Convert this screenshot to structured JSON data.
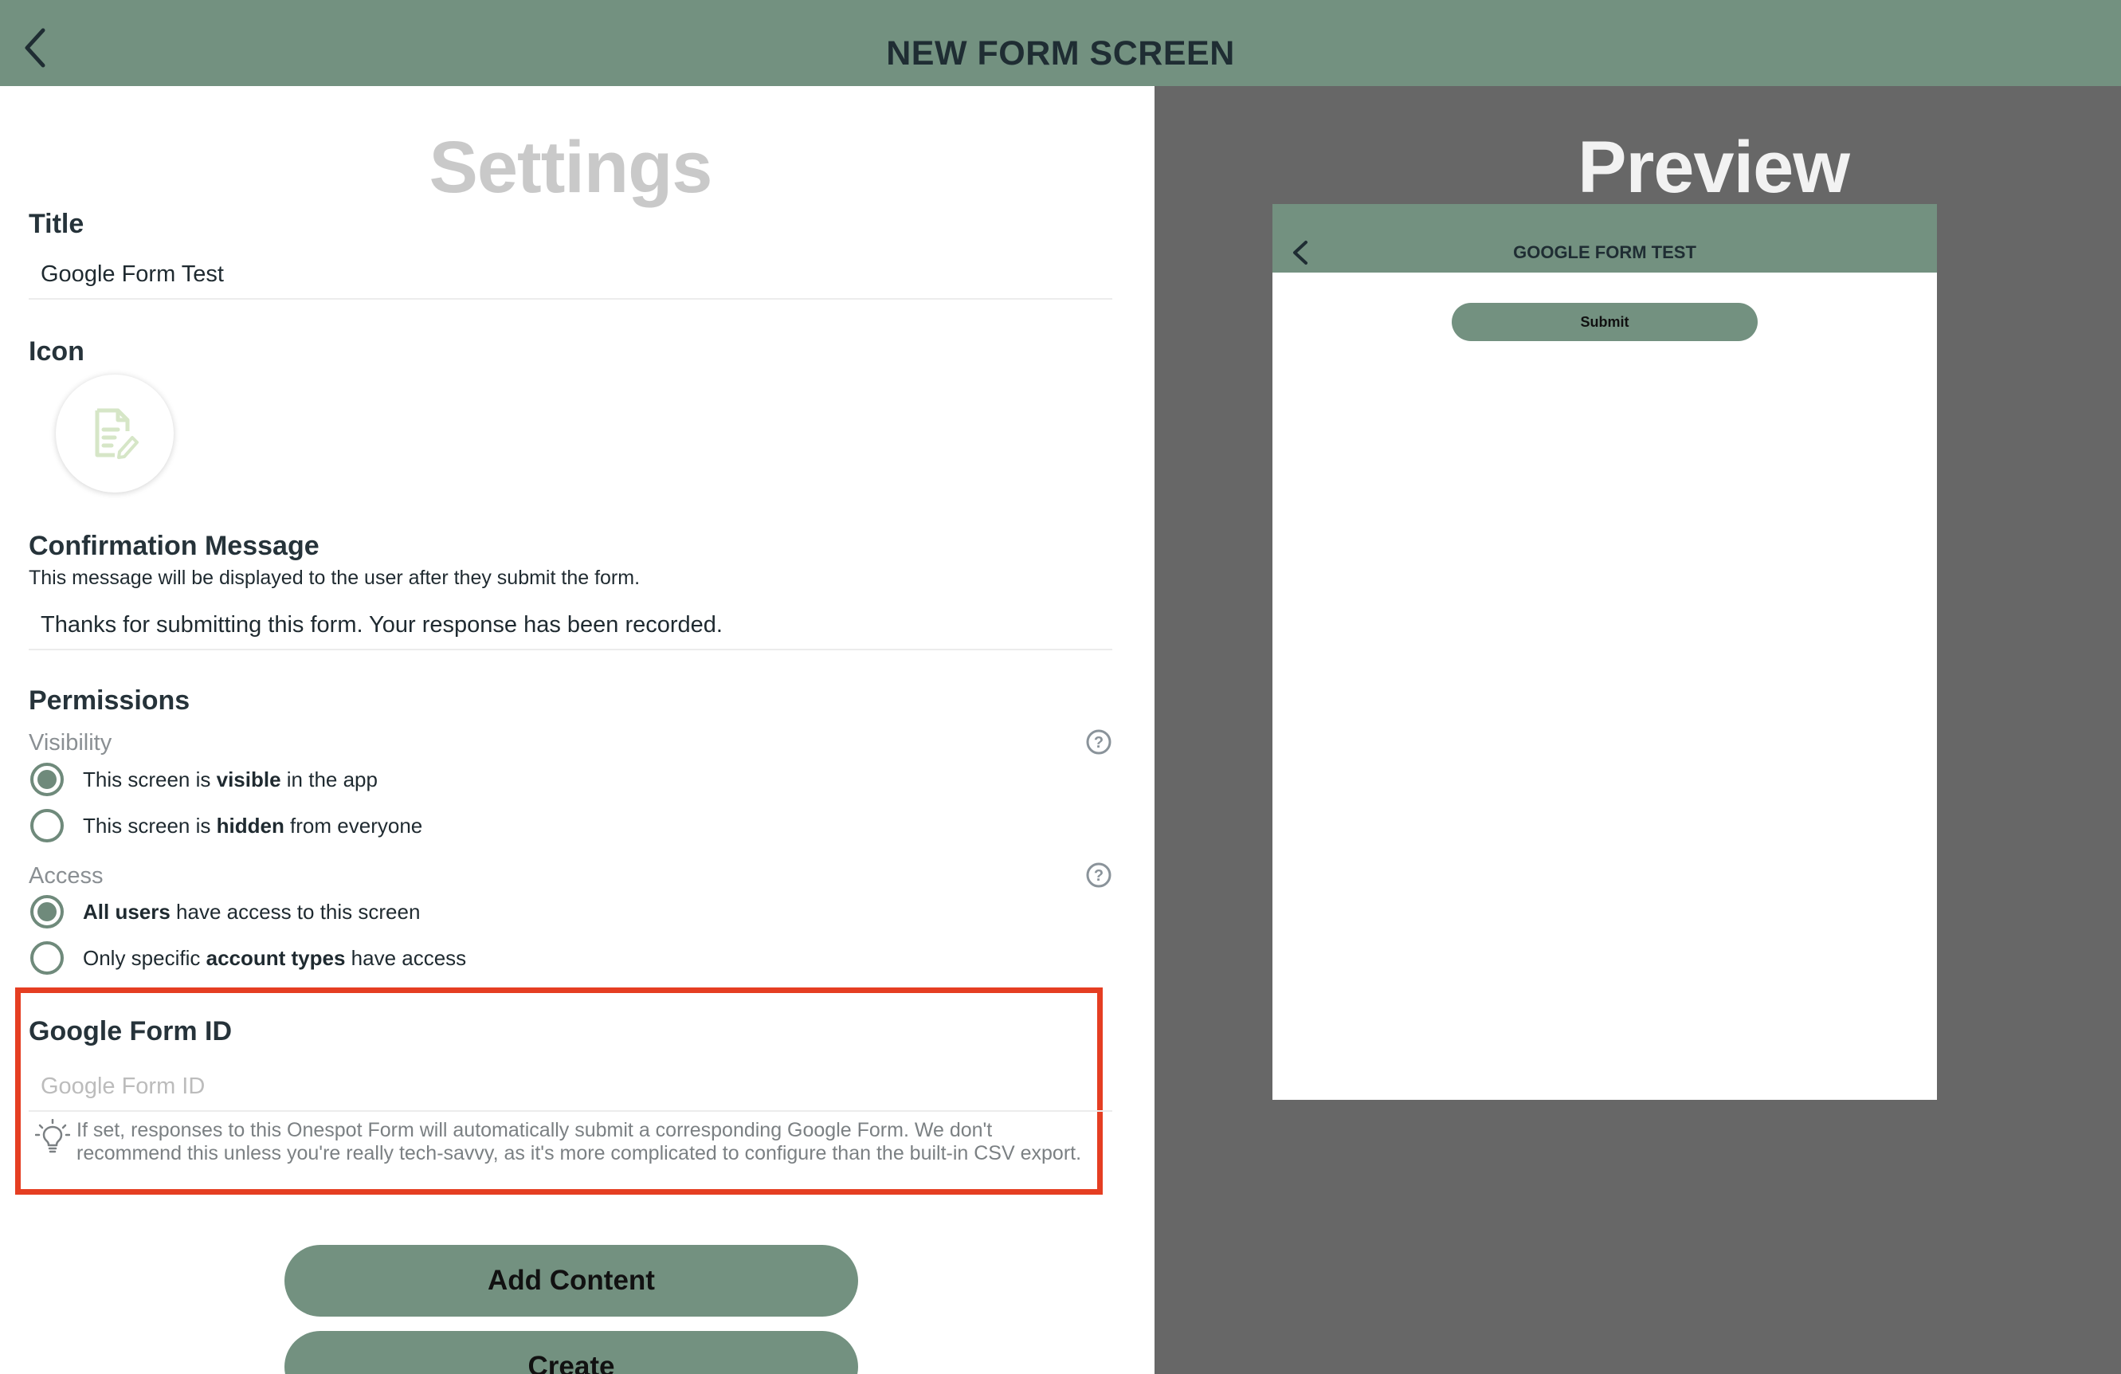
{
  "header": {
    "title": "NEW FORM SCREEN",
    "back_icon": "chevron-left-icon"
  },
  "settings": {
    "heading": "Settings",
    "title_label": "Title",
    "title_value": "Google Form Test",
    "icon_label": "Icon",
    "icon_name": "document-edit-icon",
    "confirmation_label": "Confirmation Message",
    "confirmation_helper": "This message will be displayed to the user after they submit the form.",
    "confirmation_value": "Thanks for submitting this form. Your response has been recorded.",
    "permissions_label": "Permissions",
    "visibility": {
      "label": "Visibility",
      "options": [
        {
          "pre": "This screen is ",
          "bold": "visible",
          "post": " in the app",
          "selected": true
        },
        {
          "pre": "This screen is ",
          "bold": "hidden",
          "post": " from everyone",
          "selected": false
        }
      ]
    },
    "access": {
      "label": "Access",
      "options": [
        {
          "pre": "",
          "bold": "All users",
          "post": " have access to this screen",
          "selected": true
        },
        {
          "pre": "Only specific ",
          "bold": "account types",
          "post": " have access",
          "selected": false
        }
      ]
    },
    "google_form": {
      "label": "Google Form ID",
      "placeholder": "Google Form ID",
      "value": "",
      "tip": "If set, responses to this Onespot Form will automatically submit a corresponding Google Form. We don't recommend this unless you're really tech-savvy, as it's more complicated to configure than the built-in CSV export."
    },
    "add_content_label": "Add Content",
    "create_label": "Create"
  },
  "preview": {
    "heading": "Preview",
    "screen_title": "GOOGLE FORM TEST",
    "submit_label": "Submit"
  },
  "colors": {
    "accent": "#739180",
    "highlight": "#e53e22",
    "preview_bg": "#676767"
  }
}
